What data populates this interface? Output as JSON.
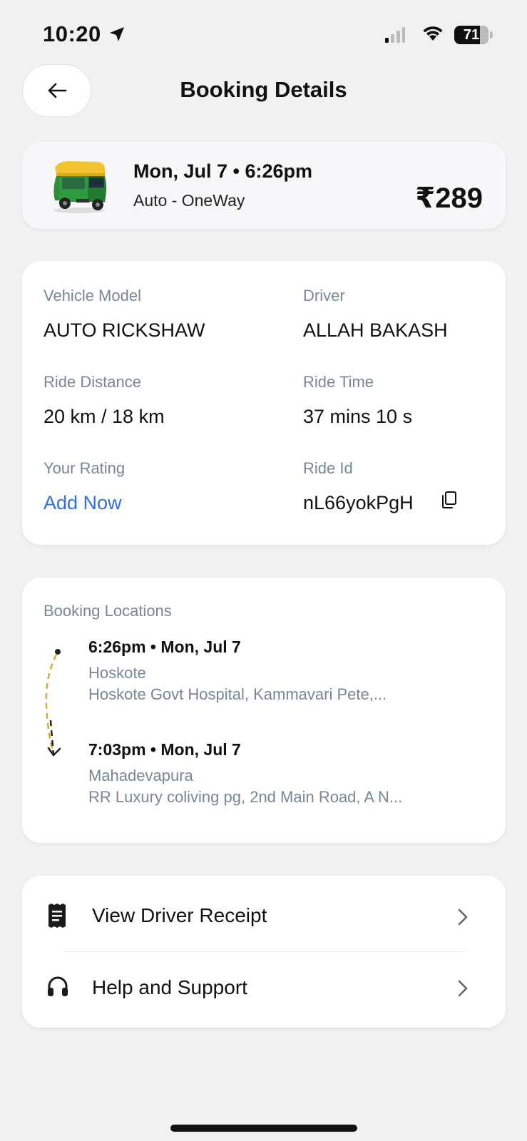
{
  "status_bar": {
    "time": "10:20",
    "battery": "71"
  },
  "header": {
    "title": "Booking Details"
  },
  "summary": {
    "date_time": "Mon, Jul 7 • 6:26pm",
    "ride_type": "Auto - OneWay",
    "price": "₹289"
  },
  "details": {
    "vehicle_model_label": "Vehicle Model",
    "vehicle_model_value": "AUTO RICKSHAW",
    "driver_label": "Driver",
    "driver_value": "ALLAH BAKASH",
    "distance_label": "Ride Distance",
    "distance_value": "20 km / 18 km",
    "time_label": "Ride Time",
    "time_value": "37 mins 10 s",
    "rating_label": "Your Rating",
    "rating_link": "Add Now",
    "ride_id_label": "Ride Id",
    "ride_id_value": "nL66yokPgH"
  },
  "locations": {
    "title": "Booking Locations",
    "pickup": {
      "time": "6:26pm • Mon, Jul 7",
      "area": "Hoskote",
      "address": "Hoskote Govt Hospital, Kammavari Pete,..."
    },
    "drop": {
      "time": "7:03pm • Mon, Jul 7",
      "area": "Mahadevapura",
      "address": "RR Luxury coliving pg, 2nd Main Road, A N..."
    }
  },
  "actions": {
    "receipt_label": "View Driver Receipt",
    "support_label": "Help and Support"
  },
  "colors": {
    "link": "#2f6fe6",
    "muted": "#7a8595",
    "background": "#f1f1f1"
  }
}
